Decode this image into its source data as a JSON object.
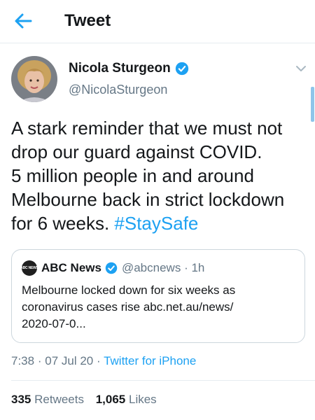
{
  "header": {
    "title": "Tweet",
    "back_icon": "arrow-left-icon"
  },
  "colors": {
    "accent": "#1da1f2",
    "secondary_text": "#657786",
    "border": "#ccd6dd",
    "text": "#14171a"
  },
  "tweet": {
    "author_name": "Nicola Sturgeon",
    "author_handle": "@NicolaSturgeon",
    "verified": true,
    "text_lines": [
      "A stark reminder that we must not",
      "drop our guard against COVID.",
      "5 million people in and around",
      "Melbourne back in strict lockdown"
    ],
    "last_line_text": "for 6 weeks. ",
    "hashtag": "#StaySafe",
    "time": "7:38",
    "date": "07 Jul 20",
    "separator": "·",
    "source": "Twitter for iPhone"
  },
  "quote": {
    "logo_text": "ABC NEWS",
    "name": "ABC News",
    "handle": "@abcnews",
    "time": "1h",
    "verified": true,
    "text_lines": [
      "Melbourne locked down for six weeks as",
      "coronavirus cases rise abc.net.au/news/",
      "2020-07-0..."
    ]
  },
  "stats": {
    "retweets_count": "335",
    "retweets_label": "Retweets",
    "likes_count": "1,065",
    "likes_label": "Likes"
  }
}
